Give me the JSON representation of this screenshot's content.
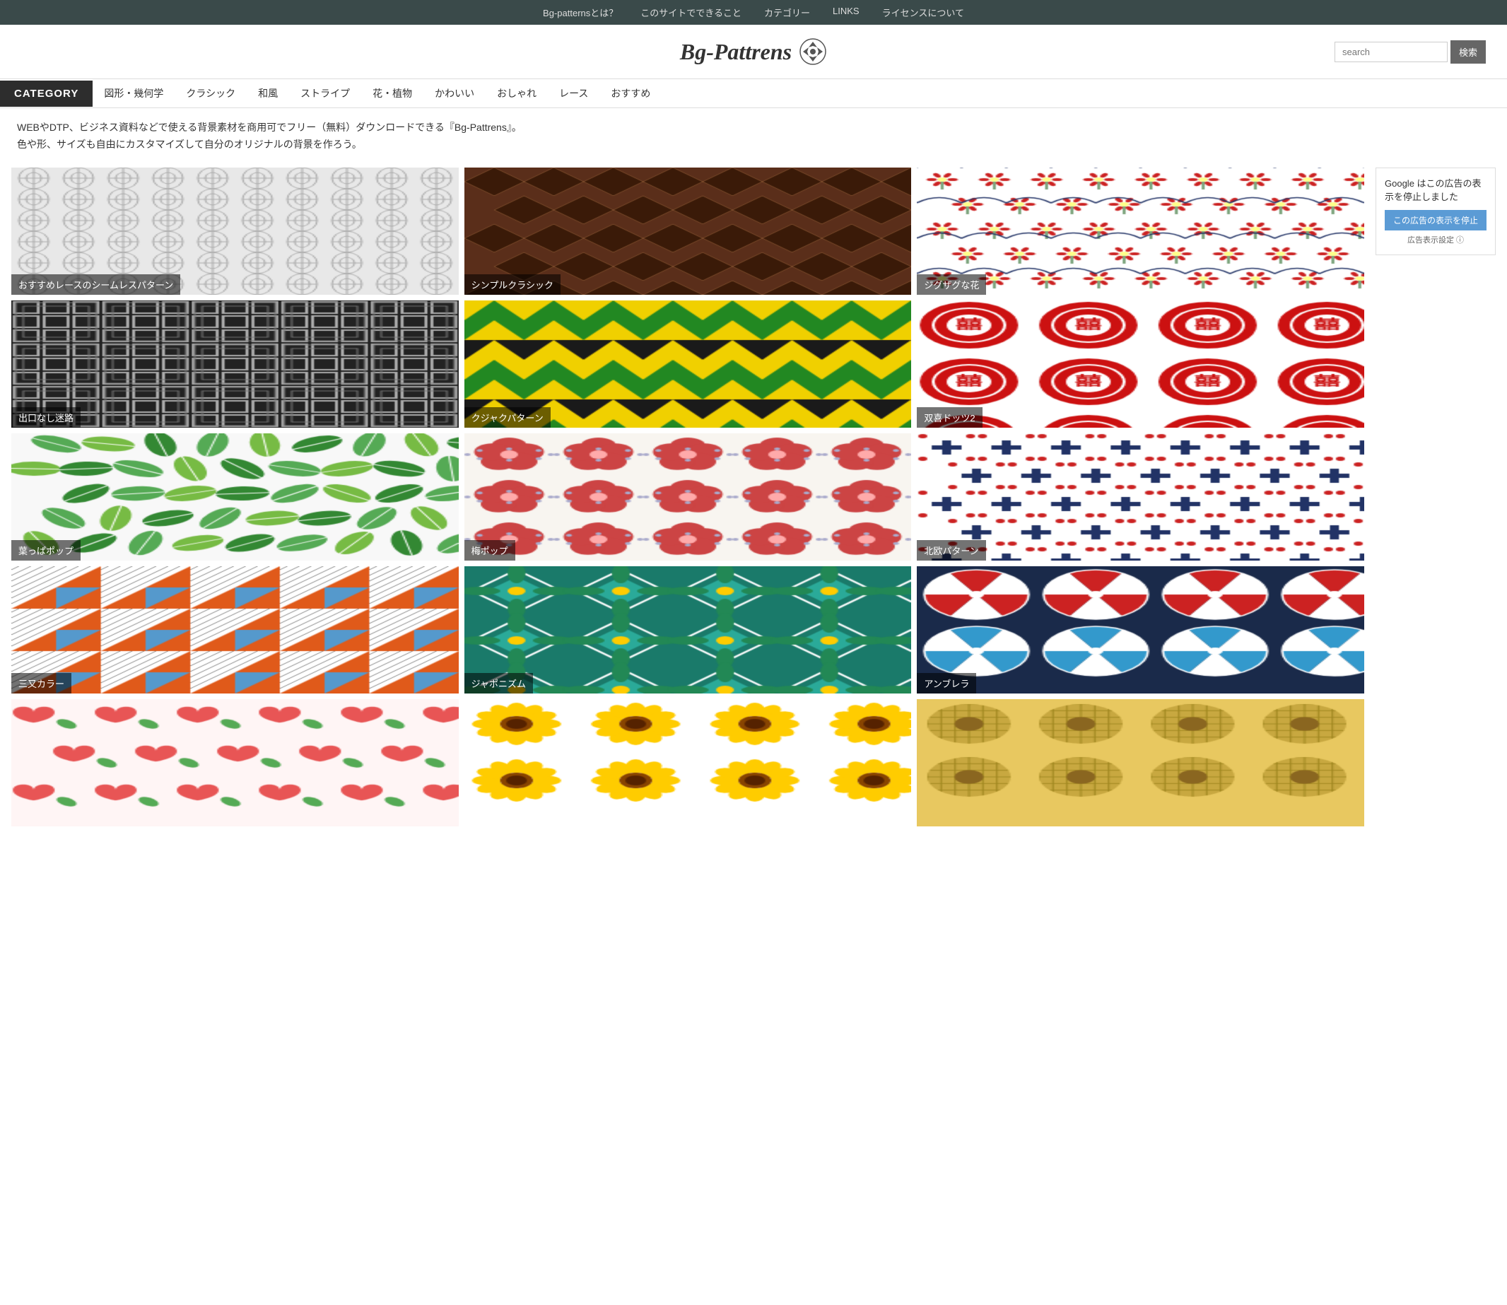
{
  "top_nav": {
    "items": [
      {
        "label": "Bg-patternsとは？",
        "id": "about"
      },
      {
        "label": "このサイトでできること",
        "id": "features"
      },
      {
        "label": "カテゴリー",
        "id": "categories"
      },
      {
        "label": "LINKS",
        "id": "links"
      },
      {
        "label": "ライセンスについて",
        "id": "license"
      }
    ]
  },
  "header": {
    "logo_text": "Bg-Pattrens",
    "search_placeholder": "search",
    "search_button_label": "検索"
  },
  "category_nav": {
    "label": "CATEGORY",
    "items": [
      {
        "label": "図形・幾何学"
      },
      {
        "label": "クラシック"
      },
      {
        "label": "和風"
      },
      {
        "label": "ストライプ"
      },
      {
        "label": "花・植物"
      },
      {
        "label": "かわいい"
      },
      {
        "label": "おしゃれ"
      },
      {
        "label": "レース"
      },
      {
        "label": "おすすめ"
      }
    ]
  },
  "description": {
    "line1": "WEBやDTP、ビジネス資料などで使える背景素材を商用可でフリー（無料）ダウンロードできる『Bg-Pattrens』。",
    "line2": "色や形、サイズも自由にカスタマイズして自分のオリジナルの背景を作ろう。"
  },
  "patterns": [
    {
      "id": "lace",
      "label": "おすすめレースのシームレスパターン",
      "type": "lace"
    },
    {
      "id": "classic",
      "label": "シンプルクラシック",
      "type": "classic"
    },
    {
      "id": "zigzag",
      "label": "ジグザグな花",
      "type": "zigzag"
    },
    {
      "id": "maze",
      "label": "出口なし迷路",
      "type": "maze"
    },
    {
      "id": "peacock",
      "label": "クジャクパターン",
      "type": "peacock"
    },
    {
      "id": "shuangxi",
      "label": "双喜ドッツ2",
      "type": "shuangxi"
    },
    {
      "id": "leaf",
      "label": "葉っぱポップ",
      "type": "leaf"
    },
    {
      "id": "ume",
      "label": "梅ポップ",
      "type": "ume"
    },
    {
      "id": "nordic",
      "label": "北欧パターン",
      "type": "nordic"
    },
    {
      "id": "tri",
      "label": "三又カラー",
      "type": "tri"
    },
    {
      "id": "japonisme",
      "label": "ジャポニズム",
      "type": "japonisme"
    },
    {
      "id": "umbrella",
      "label": "アンブレラ",
      "type": "umbrella"
    },
    {
      "id": "heart",
      "label": "",
      "type": "heart"
    },
    {
      "id": "sunflower",
      "label": "",
      "type": "sunflower"
    },
    {
      "id": "cookie",
      "label": "",
      "type": "cookie"
    }
  ],
  "ad": {
    "text": "Google はこの広告の表示を停止しました",
    "stop_button": "この広告の表示を停止",
    "settings": "広告表示設定 ⓘ"
  }
}
